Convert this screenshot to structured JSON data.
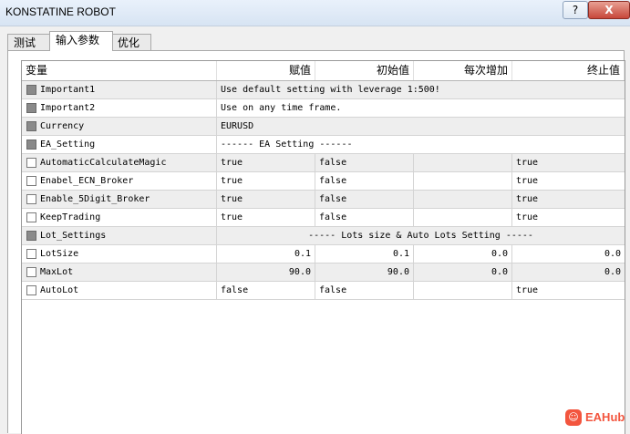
{
  "window": {
    "title": "KONSTATINE ROBOT",
    "help_label": "?",
    "close_label": "X"
  },
  "tabs": [
    {
      "label": "测试"
    },
    {
      "label": "输入参数"
    },
    {
      "label": "优化"
    }
  ],
  "columns": {
    "variable": "变量",
    "value": "赋值",
    "start": "初始值",
    "step": "每次增加",
    "stop": "终止值"
  },
  "rows": [
    {
      "name": "Important1",
      "text": "Use default setting with leverage 1:500!"
    },
    {
      "name": "Important2",
      "text": "Use on any time frame."
    },
    {
      "name": "Currency",
      "text": "EURUSD"
    },
    {
      "name": "EA_Setting",
      "text": "------ EA Setting ------"
    },
    {
      "name": "AutomaticCalculateMagic",
      "value": "true",
      "start": "false",
      "step": "",
      "stop": "true"
    },
    {
      "name": "Enabel_ECN_Broker",
      "value": "true",
      "start": "false",
      "step": "",
      "stop": "true"
    },
    {
      "name": "Enable_5Digit_Broker",
      "value": "true",
      "start": "false",
      "step": "",
      "stop": "true"
    },
    {
      "name": "KeepTrading",
      "value": "true",
      "start": "false",
      "step": "",
      "stop": "true"
    },
    {
      "name": "Lot_Settings",
      "text": "----- Lots size & Auto Lots Setting -----"
    },
    {
      "name": "LotSize",
      "value": "0.1",
      "start": "0.1",
      "step": "0.0",
      "stop": "0.0"
    },
    {
      "name": "MaxLot",
      "value": "90.0",
      "start": "90.0",
      "step": "0.0",
      "stop": "0.0"
    },
    {
      "name": "AutoLot",
      "value": "false",
      "start": "false",
      "step": "",
      "stop": "true"
    }
  ],
  "logo": {
    "text": "EAHub"
  }
}
